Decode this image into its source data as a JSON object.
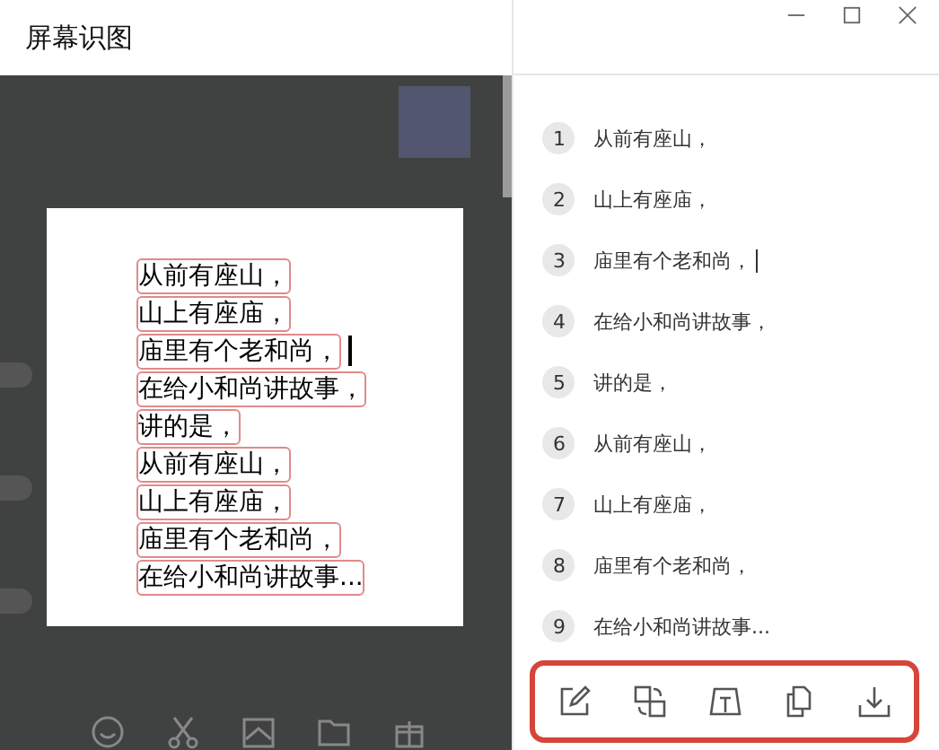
{
  "window": {
    "title": "屏幕识图"
  },
  "image": {
    "lines": [
      {
        "text": "从前有座山，",
        "cursor": false
      },
      {
        "text": "山上有座庙，",
        "cursor": false
      },
      {
        "text": "庙里有个老和尚，",
        "cursor": true
      },
      {
        "text": "在给小和尚讲故事，",
        "cursor": false
      },
      {
        "text": "讲的是，",
        "cursor": false
      },
      {
        "text": "从前有座山，",
        "cursor": false
      },
      {
        "text": "山上有座庙，",
        "cursor": false
      },
      {
        "text": "庙里有个老和尚，",
        "cursor": false
      },
      {
        "text": "在给小和尚讲故事...",
        "cursor": false
      }
    ]
  },
  "results": [
    {
      "number": "1",
      "text": "从前有座山，",
      "cursor": false
    },
    {
      "number": "2",
      "text": "山上有座庙，",
      "cursor": false
    },
    {
      "number": "3",
      "text": "庙里有个老和尚，",
      "cursor": true
    },
    {
      "number": "4",
      "text": "在给小和尚讲故事，",
      "cursor": false
    },
    {
      "number": "5",
      "text": "讲的是，",
      "cursor": false
    },
    {
      "number": "6",
      "text": "从前有座山，",
      "cursor": false
    },
    {
      "number": "7",
      "text": "山上有座庙，",
      "cursor": false
    },
    {
      "number": "8",
      "text": "庙里有个老和尚，",
      "cursor": false
    },
    {
      "number": "9",
      "text": "在给小和尚讲故事...",
      "cursor": false
    }
  ],
  "toolbar": [
    {
      "kind": "edit"
    },
    {
      "kind": "translate"
    },
    {
      "kind": "extract"
    },
    {
      "kind": "copy"
    },
    {
      "kind": "download"
    }
  ]
}
